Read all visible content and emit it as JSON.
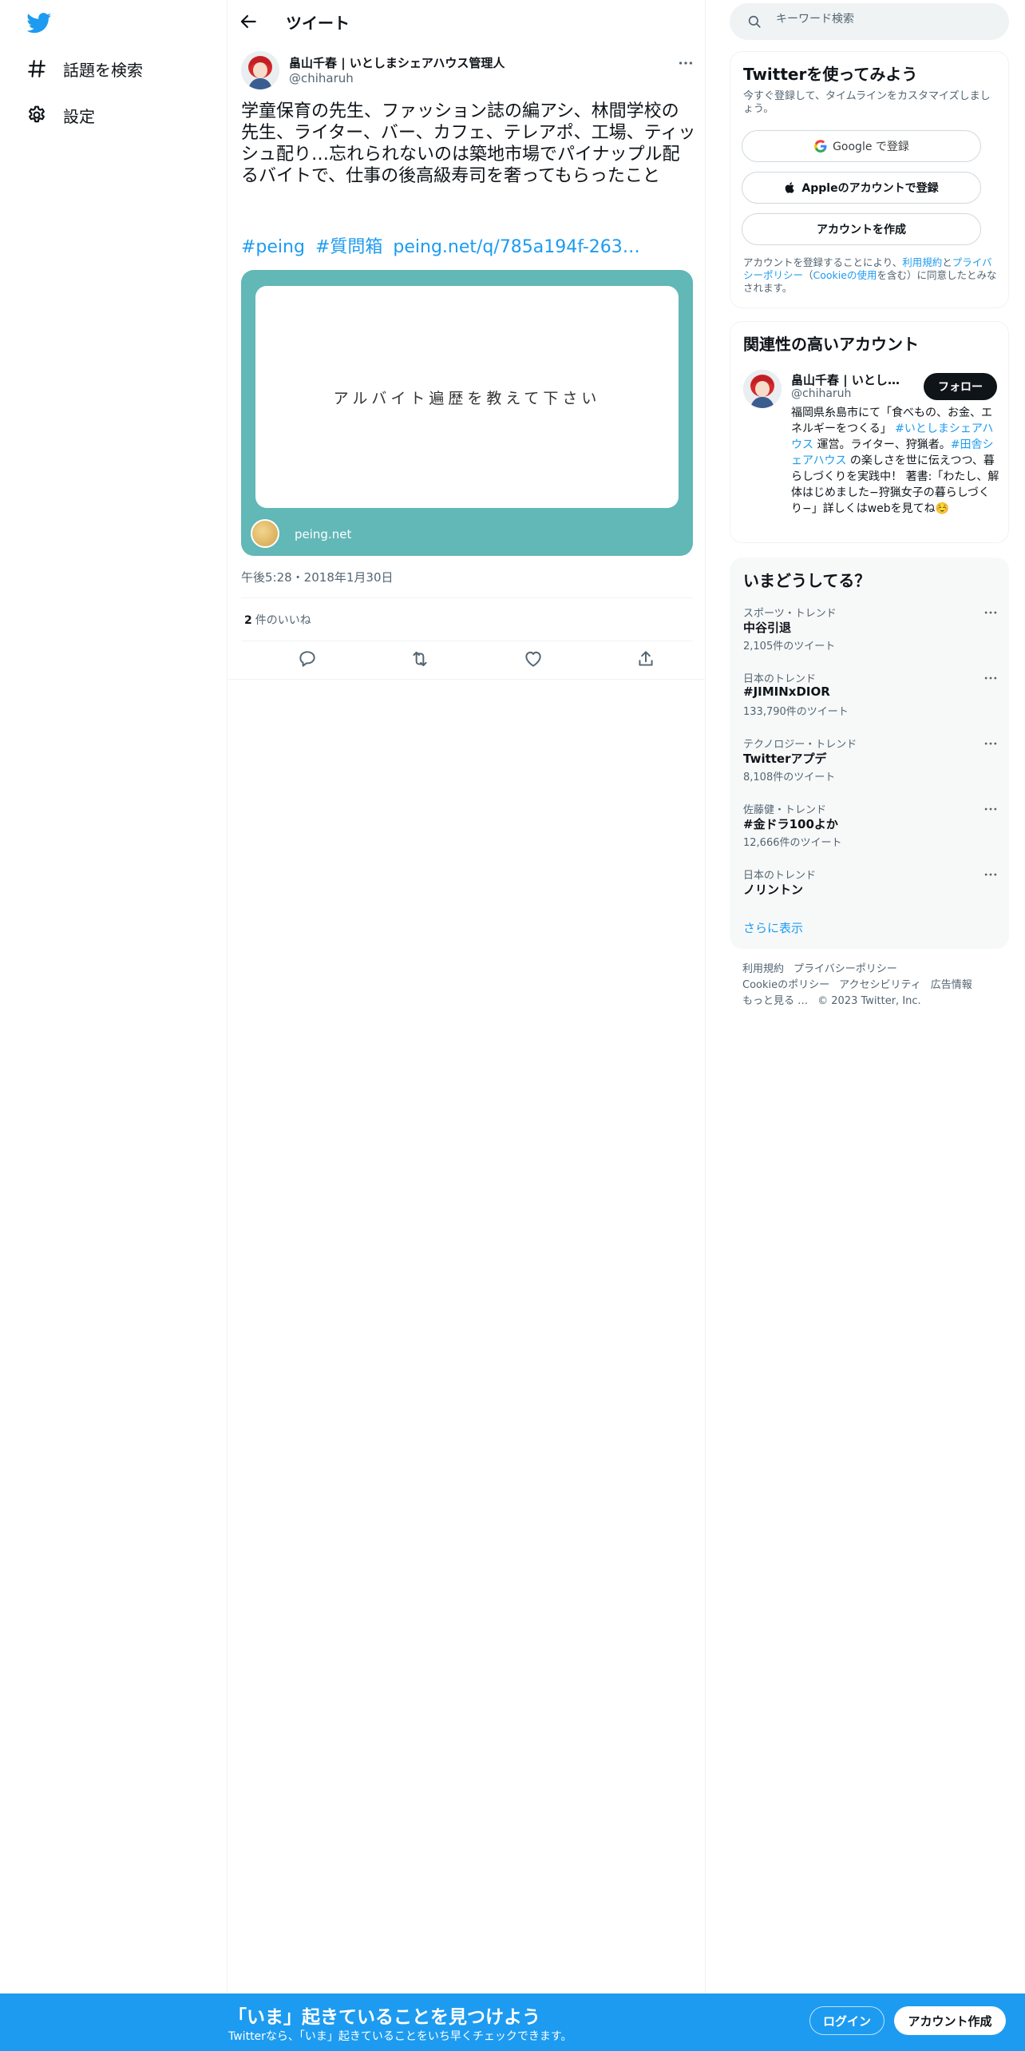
{
  "nav": {
    "logo": "twitter-bird-icon",
    "items": [
      {
        "label": "話題を検索",
        "icon": "hashtag-icon"
      },
      {
        "label": "設定",
        "icon": "gear-icon"
      }
    ]
  },
  "header": {
    "title": "ツイート"
  },
  "tweet": {
    "name": "畠山千春 | いとしまシェアハウス管理人",
    "handle": "@chiharuh",
    "text": "学童保育の先生、ファッション誌の編アシ、林間学校の先生、ライター、バー、カフェ、テレアポ、工場、ティッシュ配り…忘れられないのは築地市場でパイナップル配るバイトで、仕事の後高級寿司を奢ってもらったこと",
    "links": [
      "#peing",
      "#質問箱",
      "peing.net/q/785a194f-263…"
    ],
    "card": {
      "question": "アルバイト遍歴を教えて下さい",
      "domain": "peing.net"
    },
    "time": "午後5:28・2018年1月30日",
    "likes_count": "2",
    "likes_label": "件のいいね"
  },
  "search": {
    "placeholder": "キーワード検索"
  },
  "signup": {
    "title": "Twitterを使ってみよう",
    "subtitle": "今すぐ登録して、タイムラインをカスタマイズしましょう。",
    "google": "Google で登録",
    "apple": "Appleのアカウントで登録",
    "create": "アカウントを作成",
    "note_1": "アカウントを登録することにより、",
    "note_terms": "利用規約",
    "note_2": "と",
    "note_privacy": "プライバシーポリシー",
    "note_3": "（",
    "note_cookie": "Cookieの使用",
    "note_4": "を含む）に同意したとみなされます。"
  },
  "related": {
    "title": "関連性の高いアカウント",
    "name": "畠山千春 | いとしまシェアハウス管理人",
    "handle": "@chiharuh",
    "follow": "フォロー",
    "bio_1": "福岡県糸島市にて「食べもの、お金、エネルギーをつくる」 ",
    "bio_tag1": "#いとしまシェアハウス",
    "bio_2": " 運営。ライター、狩猟者。",
    "bio_tag2": "#田舎シェアハウス",
    "bio_3": " の楽しさを世に伝えつつ、暮らしづくりを実践中！ 著書:「わたし、解体はじめました−狩猟女子の暮らしづくり−」詳しくはwebを見てね☺️"
  },
  "trends": {
    "title": "いまどうしてる？",
    "items": [
      {
        "category": "スポーツ・トレンド",
        "name": "中谷引退",
        "count": "2,105件のツイート"
      },
      {
        "category": "日本のトレンド",
        "name": "#JIMINxDIOR",
        "count": "133,790件のツイート"
      },
      {
        "category": "テクノロジー・トレンド",
        "name": "Twitterアプデ",
        "count": "8,108件のツイート"
      },
      {
        "category": "佐藤健・トレンド",
        "name": "#金ドラ100よか",
        "count": "12,666件のツイート"
      },
      {
        "category": "日本のトレンド",
        "name": "ノリントン",
        "count": ""
      }
    ],
    "show_more": "さらに表示"
  },
  "footer": {
    "links": [
      "利用規約",
      "プライバシーポリシー",
      "Cookieのポリシー",
      "アクセシビリティ",
      "広告情報",
      "もっと見る …"
    ],
    "copyright": "© 2023 Twitter, Inc."
  },
  "bottom_bar": {
    "title": "「いま」起きていることを見つけよう",
    "subtitle": "Twitterなら、「いま」起きていることをいち早くチェックできます。",
    "login": "ログイン",
    "signup": "アカウント作成"
  },
  "colors": {
    "brand": "#1d9bf0",
    "card_bg": "#62b7b7",
    "text": "#0f1419",
    "muted": "#536471"
  }
}
